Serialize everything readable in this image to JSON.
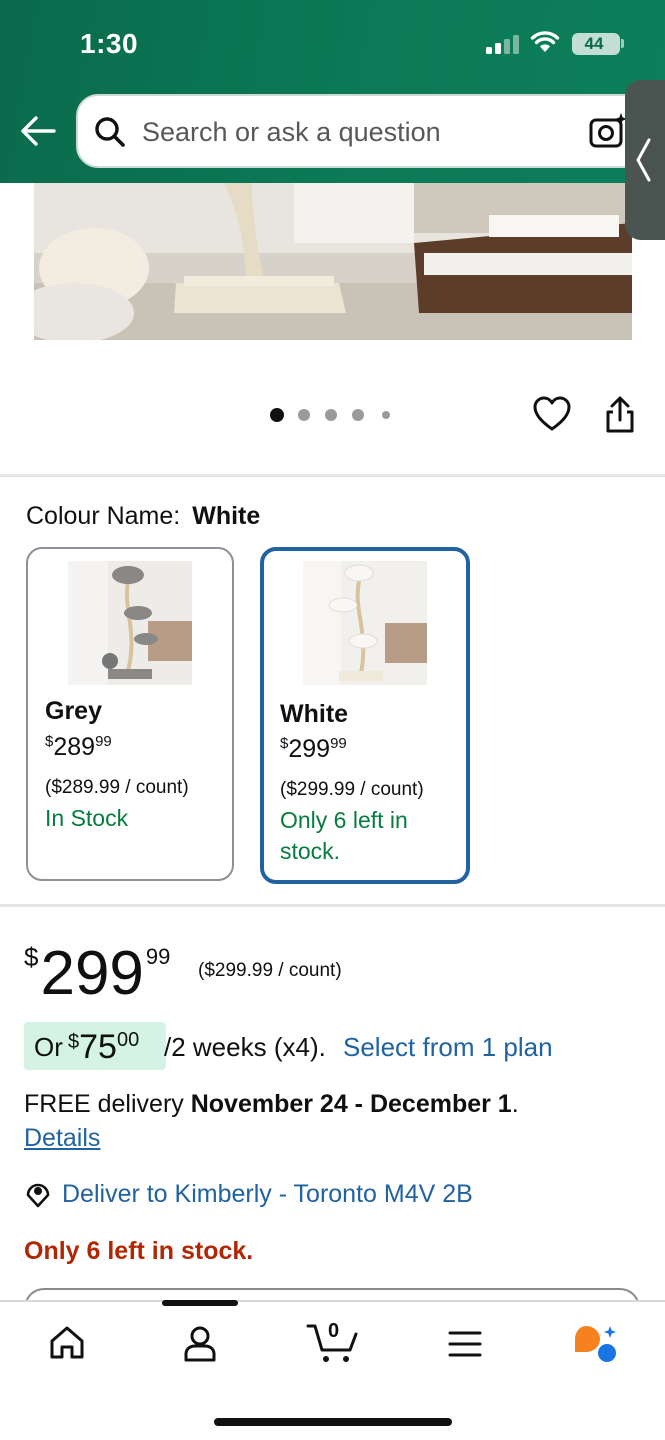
{
  "status_bar": {
    "time": "1:30",
    "battery": "44"
  },
  "search": {
    "placeholder": "Search or ask a question"
  },
  "image_carousel": {
    "total_dots": 5,
    "active_index": 0
  },
  "colour": {
    "label": "Colour Name:",
    "selected": "White"
  },
  "variants": [
    {
      "name": "Grey",
      "currency": "$",
      "price_whole": "289",
      "price_cents": "99",
      "unit_price": "($289.99 / count)",
      "stock": "In Stock",
      "selected": false
    },
    {
      "name": "White",
      "currency": "$",
      "price_whole": "299",
      "price_cents": "99",
      "unit_price": "($299.99 / count)",
      "stock": "Only 6 left in stock.",
      "selected": true
    }
  ],
  "price": {
    "currency": "$",
    "whole": "299",
    "cents": "99",
    "unit": "($299.99 / count)"
  },
  "payment_plan": {
    "prefix": "Or",
    "currency": "$",
    "whole": "75",
    "cents": "00",
    "terms": "/2 weeks (x4).",
    "link": "Select from 1 plan"
  },
  "delivery": {
    "prefix": "FREE delivery",
    "dates": "November 24 - December 1",
    "suffix": ".",
    "details_link": "Details",
    "deliver_to": "Deliver to Kimberly - Toronto M4V 2B"
  },
  "stock_warning": "Only 6 left in stock.",
  "bottom_nav": {
    "cart_count": "0",
    "items": [
      "home-icon",
      "account-icon",
      "cart-icon",
      "menu-icon",
      "rufus-assistant-icon"
    ]
  },
  "colors": {
    "header_green": "#0b7a56",
    "link_blue": "#2162a1",
    "stock_green": "#067d3f",
    "warning_red": "#b12704",
    "plan_badge": "#d5f3e5",
    "selected_border": "#2162a1"
  }
}
